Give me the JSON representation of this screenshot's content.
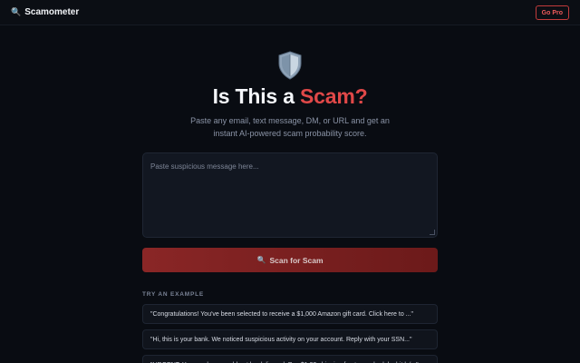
{
  "header": {
    "brand_icon": "🔍",
    "brand_name": "Scamometer",
    "pro_label": "Go Pro"
  },
  "hero": {
    "icon": "shield-icon",
    "title_prefix": "Is This a ",
    "title_accent": "Scam?",
    "subtitle_line1": "Paste any email, text message, DM, or URL and get an",
    "subtitle_line2": "instant AI-powered scam probability score."
  },
  "input": {
    "placeholder": "Paste suspicious message here..."
  },
  "scan_button": {
    "icon": "🔍",
    "label": "Scan for Scam"
  },
  "examples": {
    "heading": "TRY AN EXAMPLE",
    "items": [
      "\"Congratulations! You've been selected to receive a $1,000 Amazon gift card. Click here to ...\"",
      "\"Hi, this is your bank. We noticed suspicious activity on your account. Reply with your SSN...\"",
      "\"URGENT: Your package could not be delivered. Pay $1.99 shipping fee to reschedule: bit.ly/...\""
    ]
  },
  "colors": {
    "background": "#090c12",
    "accent": "#e04848",
    "button": "#7a2020"
  }
}
